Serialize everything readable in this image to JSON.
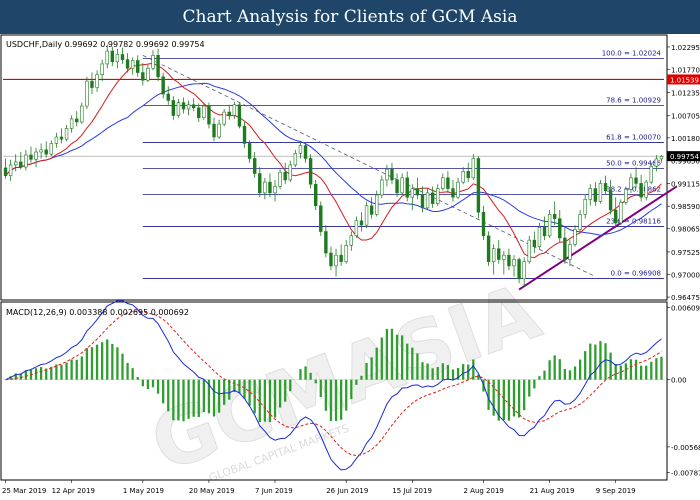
{
  "banner": {
    "title": "Chart Analysis for Clients of GCM Asia",
    "background": "#1f4668"
  },
  "watermark": {
    "text": "GCMASIA",
    "subtext": "GLOBAL CAPITAL MARKETS"
  },
  "chart_data": [
    {
      "type": "candlestick",
      "header": "USDCHF,Daily  0.99692 0.99782 0.99692 0.99754",
      "ylim": [
        0.9643,
        1.0255
      ],
      "y_ticks": [
        {
          "label": "1.02295",
          "value": 1.02295
        },
        {
          "label": "1.01770",
          "value": 1.0177
        },
        {
          "label": "1.01235",
          "value": 1.01235
        },
        {
          "label": "1.00705",
          "value": 1.00705
        },
        {
          "label": "1.00180",
          "value": 1.0018
        },
        {
          "label": "0.99650",
          "value": 0.9965
        },
        {
          "label": "0.99115",
          "value": 0.99115
        },
        {
          "label": "0.98590",
          "value": 0.9859
        },
        {
          "label": "0.98065",
          "value": 0.98065
        },
        {
          "label": "0.97525",
          "value": 0.97525
        },
        {
          "label": "0.97000",
          "value": 0.97
        },
        {
          "label": "0.96475",
          "value": 0.96475
        }
      ],
      "fib_levels": [
        {
          "label": "100.0 = 1.02024",
          "value": 1.02024
        },
        {
          "label": "78.6 = 1.00929",
          "value": 1.00929
        },
        {
          "label": "61.8 = 1.00070",
          "value": 1.0007
        },
        {
          "label": "50.0 = 0.99466",
          "value": 0.99466
        },
        {
          "label": "38.2 = 0.98862",
          "value": 0.98862
        },
        {
          "label": "23.6 = 0.98116",
          "value": 0.98116
        },
        {
          "label": "0.0 = 0.96908",
          "value": 0.96908
        }
      ],
      "resistance_level": {
        "label": "1.01539",
        "value": 1.01539
      },
      "current_price": {
        "label": "0.99754",
        "value": 0.99754
      },
      "colors": {
        "fib": "#1c1c8a",
        "resistance": "#e00000",
        "ma_fast": "#d21e1e",
        "ma_slow": "#2a3ce0",
        "trendline": "#800080",
        "downtrend": "#555577",
        "candle": "#1f7a1f",
        "current_price_bg": "#000000"
      },
      "ohlc": [
        {
          "o": 0.9948,
          "h": 0.997,
          "l": 0.9923,
          "c": 0.993
        },
        {
          "o": 0.993,
          "h": 0.9967,
          "l": 0.9918,
          "c": 0.9955
        },
        {
          "o": 0.9955,
          "h": 0.998,
          "l": 0.994,
          "c": 0.9962
        },
        {
          "o": 0.9962,
          "h": 0.9985,
          "l": 0.9945,
          "c": 0.995
        },
        {
          "o": 0.995,
          "h": 0.999,
          "l": 0.9942,
          "c": 0.9978
        },
        {
          "o": 0.9978,
          "h": 0.9998,
          "l": 0.996,
          "c": 0.9968
        },
        {
          "o": 0.9968,
          "h": 0.9995,
          "l": 0.995,
          "c": 0.9985
        },
        {
          "o": 0.9985,
          "h": 1.0005,
          "l": 0.997,
          "c": 0.999
        },
        {
          "o": 0.999,
          "h": 1.001,
          "l": 0.9972,
          "c": 0.998
        },
        {
          "o": 0.998,
          "h": 1.0012,
          "l": 0.9975,
          "c": 1.0005
        },
        {
          "o": 1.0005,
          "h": 1.003,
          "l": 0.9995,
          "c": 1.002
        },
        {
          "o": 1.002,
          "h": 1.004,
          "l": 1.0005,
          "c": 1.0015
        },
        {
          "o": 1.0015,
          "h": 1.0048,
          "l": 1.001,
          "c": 1.004
        },
        {
          "o": 1.004,
          "h": 1.007,
          "l": 1.003,
          "c": 1.0062
        },
        {
          "o": 1.0062,
          "h": 1.008,
          "l": 1.0045,
          "c": 1.0055
        },
        {
          "o": 1.0055,
          "h": 1.01,
          "l": 1.005,
          "c": 1.0092
        },
        {
          "o": 1.0092,
          "h": 1.016,
          "l": 1.0085,
          "c": 1.015
        },
        {
          "o": 1.015,
          "h": 1.017,
          "l": 1.012,
          "c": 1.0135
        },
        {
          "o": 1.0135,
          "h": 1.0175,
          "l": 1.0125,
          "c": 1.0165
        },
        {
          "o": 1.0165,
          "h": 1.02,
          "l": 1.015,
          "c": 1.019
        },
        {
          "o": 1.019,
          "h": 1.0235,
          "l": 1.018,
          "c": 1.022
        },
        {
          "o": 1.022,
          "h": 1.023,
          "l": 1.0185,
          "c": 1.0195
        },
        {
          "o": 1.0195,
          "h": 1.0225,
          "l": 1.018,
          "c": 1.0212
        },
        {
          "o": 1.0212,
          "h": 1.0228,
          "l": 1.019,
          "c": 1.02
        },
        {
          "o": 1.02,
          "h": 1.0215,
          "l": 1.017,
          "c": 1.018
        },
        {
          "o": 1.018,
          "h": 1.0205,
          "l": 1.0165,
          "c": 1.0198
        },
        {
          "o": 1.0198,
          "h": 1.021,
          "l": 1.016,
          "c": 1.017
        },
        {
          "o": 1.017,
          "h": 1.0192,
          "l": 1.014,
          "c": 1.0152
        },
        {
          "o": 1.0152,
          "h": 1.0188,
          "l": 1.0148,
          "c": 1.018
        },
        {
          "o": 1.018,
          "h": 1.0222,
          "l": 1.0175,
          "c": 1.021
        },
        {
          "o": 1.021,
          "h": 1.0225,
          "l": 1.015,
          "c": 1.016
        },
        {
          "o": 1.016,
          "h": 1.017,
          "l": 1.011,
          "c": 1.012
        },
        {
          "o": 1.012,
          "h": 1.0138,
          "l": 1.0095,
          "c": 1.0105
        },
        {
          "o": 1.0105,
          "h": 1.0115,
          "l": 1.006,
          "c": 1.007
        },
        {
          "o": 1.007,
          "h": 1.0108,
          "l": 1.0065,
          "c": 1.01
        },
        {
          "o": 1.01,
          "h": 1.0112,
          "l": 1.0075,
          "c": 1.0085
        },
        {
          "o": 1.0085,
          "h": 1.0105,
          "l": 1.007,
          "c": 1.0095
        },
        {
          "o": 1.0095,
          "h": 1.011,
          "l": 1.008,
          "c": 1.0088
        },
        {
          "o": 1.0088,
          "h": 1.0098,
          "l": 1.0055,
          "c": 1.0065
        },
        {
          "o": 1.0065,
          "h": 1.01,
          "l": 1.006,
          "c": 1.0092
        },
        {
          "o": 1.0092,
          "h": 1.01,
          "l": 1.004,
          "c": 1.005
        },
        {
          "o": 1.005,
          "h": 1.0065,
          "l": 1.001,
          "c": 1.002
        },
        {
          "o": 1.002,
          "h": 1.006,
          "l": 1.0015,
          "c": 1.005
        },
        {
          "o": 1.005,
          "h": 1.0085,
          "l": 1.0045,
          "c": 1.0078
        },
        {
          "o": 1.0078,
          "h": 1.0095,
          "l": 1.006,
          "c": 1.007
        },
        {
          "o": 1.007,
          "h": 1.0102,
          "l": 1.0062,
          "c": 1.0095
        },
        {
          "o": 1.0095,
          "h": 1.01,
          "l": 1.004,
          "c": 1.0045
        },
        {
          "o": 1.0045,
          "h": 1.0055,
          "l": 0.9995,
          "c": 1.0005
        },
        {
          "o": 1.0005,
          "h": 1.0012,
          "l": 0.996,
          "c": 0.997
        },
        {
          "o": 0.997,
          "h": 0.9985,
          "l": 0.9925,
          "c": 0.9935
        },
        {
          "o": 0.9935,
          "h": 0.995,
          "l": 0.988,
          "c": 0.989
        },
        {
          "o": 0.989,
          "h": 0.9925,
          "l": 0.9875,
          "c": 0.9915
        },
        {
          "o": 0.9915,
          "h": 0.9935,
          "l": 0.988,
          "c": 0.989
        },
        {
          "o": 0.989,
          "h": 0.992,
          "l": 0.987,
          "c": 0.9905
        },
        {
          "o": 0.9905,
          "h": 0.9945,
          "l": 0.9898,
          "c": 0.9938
        },
        {
          "o": 0.9938,
          "h": 0.996,
          "l": 0.991,
          "c": 0.992
        },
        {
          "o": 0.992,
          "h": 0.9965,
          "l": 0.9915,
          "c": 0.9955
        },
        {
          "o": 0.9955,
          "h": 0.999,
          "l": 0.995,
          "c": 0.9982
        },
        {
          "o": 0.9982,
          "h": 1.001,
          "l": 0.997,
          "c": 1.0
        },
        {
          "o": 1.0,
          "h": 1.0008,
          "l": 0.996,
          "c": 0.997
        },
        {
          "o": 0.997,
          "h": 0.998,
          "l": 0.99,
          "c": 0.991
        },
        {
          "o": 0.991,
          "h": 0.992,
          "l": 0.985,
          "c": 0.986
        },
        {
          "o": 0.986,
          "h": 0.987,
          "l": 0.979,
          "c": 0.98
        },
        {
          "o": 0.98,
          "h": 0.9815,
          "l": 0.974,
          "c": 0.975
        },
        {
          "o": 0.975,
          "h": 0.9765,
          "l": 0.971,
          "c": 0.972
        },
        {
          "o": 0.972,
          "h": 0.976,
          "l": 0.9695,
          "c": 0.9745
        },
        {
          "o": 0.9745,
          "h": 0.977,
          "l": 0.972,
          "c": 0.973
        },
        {
          "o": 0.973,
          "h": 0.978,
          "l": 0.9725,
          "c": 0.9768
        },
        {
          "o": 0.9768,
          "h": 0.98,
          "l": 0.9755,
          "c": 0.979
        },
        {
          "o": 0.979,
          "h": 0.9835,
          "l": 0.9785,
          "c": 0.9825
        },
        {
          "o": 0.9825,
          "h": 0.9845,
          "l": 0.98,
          "c": 0.9815
        },
        {
          "o": 0.9815,
          "h": 0.987,
          "l": 0.9808,
          "c": 0.986
        },
        {
          "o": 0.986,
          "h": 0.988,
          "l": 0.983,
          "c": 0.984
        },
        {
          "o": 0.984,
          "h": 0.9895,
          "l": 0.9835,
          "c": 0.9885
        },
        {
          "o": 0.9885,
          "h": 0.993,
          "l": 0.9878,
          "c": 0.992
        },
        {
          "o": 0.992,
          "h": 0.9955,
          "l": 0.9905,
          "c": 0.9945
        },
        {
          "o": 0.9945,
          "h": 0.996,
          "l": 0.991,
          "c": 0.992
        },
        {
          "o": 0.992,
          "h": 0.9935,
          "l": 0.988,
          "c": 0.989
        },
        {
          "o": 0.989,
          "h": 0.9935,
          "l": 0.9885,
          "c": 0.9925
        },
        {
          "o": 0.9925,
          "h": 0.994,
          "l": 0.987,
          "c": 0.988
        },
        {
          "o": 0.988,
          "h": 0.991,
          "l": 0.985,
          "c": 0.99
        },
        {
          "o": 0.99,
          "h": 0.9925,
          "l": 0.9875,
          "c": 0.9885
        },
        {
          "o": 0.9885,
          "h": 0.9905,
          "l": 0.9845,
          "c": 0.9855
        },
        {
          "o": 0.9855,
          "h": 0.99,
          "l": 0.985,
          "c": 0.989
        },
        {
          "o": 0.989,
          "h": 0.9905,
          "l": 0.9855,
          "c": 0.9865
        },
        {
          "o": 0.9865,
          "h": 0.991,
          "l": 0.986,
          "c": 0.99
        },
        {
          "o": 0.99,
          "h": 0.9935,
          "l": 0.9895,
          "c": 0.9925
        },
        {
          "o": 0.9925,
          "h": 0.994,
          "l": 0.989,
          "c": 0.99
        },
        {
          "o": 0.99,
          "h": 0.992,
          "l": 0.987,
          "c": 0.988
        },
        {
          "o": 0.988,
          "h": 0.9925,
          "l": 0.9875,
          "c": 0.9915
        },
        {
          "o": 0.9915,
          "h": 0.995,
          "l": 0.991,
          "c": 0.994
        },
        {
          "o": 0.994,
          "h": 0.996,
          "l": 0.9915,
          "c": 0.9925
        },
        {
          "o": 0.9925,
          "h": 0.998,
          "l": 0.992,
          "c": 0.997
        },
        {
          "o": 0.997,
          "h": 0.9975,
          "l": 0.983,
          "c": 0.9845
        },
        {
          "o": 0.9845,
          "h": 0.986,
          "l": 0.978,
          "c": 0.979
        },
        {
          "o": 0.979,
          "h": 0.98,
          "l": 0.972,
          "c": 0.973
        },
        {
          "o": 0.973,
          "h": 0.977,
          "l": 0.97,
          "c": 0.976
        },
        {
          "o": 0.976,
          "h": 0.978,
          "l": 0.9725,
          "c": 0.9735
        },
        {
          "o": 0.9735,
          "h": 0.9755,
          "l": 0.97,
          "c": 0.9745
        },
        {
          "o": 0.9745,
          "h": 0.976,
          "l": 0.971,
          "c": 0.972
        },
        {
          "o": 0.972,
          "h": 0.9745,
          "l": 0.9695,
          "c": 0.9735
        },
        {
          "o": 0.9735,
          "h": 0.974,
          "l": 0.968,
          "c": 0.969
        },
        {
          "o": 0.969,
          "h": 0.974,
          "l": 0.967,
          "c": 0.973
        },
        {
          "o": 0.973,
          "h": 0.979,
          "l": 0.9725,
          "c": 0.978
        },
        {
          "o": 0.978,
          "h": 0.98,
          "l": 0.975,
          "c": 0.9765
        },
        {
          "o": 0.9765,
          "h": 0.982,
          "l": 0.976,
          "c": 0.981
        },
        {
          "o": 0.981,
          "h": 0.9835,
          "l": 0.978,
          "c": 0.979
        },
        {
          "o": 0.979,
          "h": 0.985,
          "l": 0.9785,
          "c": 0.984
        },
        {
          "o": 0.984,
          "h": 0.987,
          "l": 0.9815,
          "c": 0.983
        },
        {
          "o": 0.983,
          "h": 0.985,
          "l": 0.9775,
          "c": 0.9785
        },
        {
          "o": 0.9785,
          "h": 0.981,
          "l": 0.9725,
          "c": 0.9735
        },
        {
          "o": 0.9735,
          "h": 0.978,
          "l": 0.972,
          "c": 0.977
        },
        {
          "o": 0.977,
          "h": 0.9815,
          "l": 0.9765,
          "c": 0.9805
        },
        {
          "o": 0.9805,
          "h": 0.985,
          "l": 0.98,
          "c": 0.984
        },
        {
          "o": 0.984,
          "h": 0.9885,
          "l": 0.983,
          "c": 0.9875
        },
        {
          "o": 0.9875,
          "h": 0.991,
          "l": 0.986,
          "c": 0.99
        },
        {
          "o": 0.99,
          "h": 0.9915,
          "l": 0.986,
          "c": 0.987
        },
        {
          "o": 0.987,
          "h": 0.992,
          "l": 0.9865,
          "c": 0.9912
        },
        {
          "o": 0.9912,
          "h": 0.993,
          "l": 0.9885,
          "c": 0.9895
        },
        {
          "o": 0.9895,
          "h": 0.992,
          "l": 0.984,
          "c": 0.985
        },
        {
          "o": 0.985,
          "h": 0.988,
          "l": 0.9808,
          "c": 0.982
        },
        {
          "o": 0.982,
          "h": 0.9875,
          "l": 0.9815,
          "c": 0.9868
        },
        {
          "o": 0.9868,
          "h": 0.9905,
          "l": 0.9862,
          "c": 0.9898
        },
        {
          "o": 0.9898,
          "h": 0.9935,
          "l": 0.989,
          "c": 0.9925
        },
        {
          "o": 0.9925,
          "h": 0.995,
          "l": 0.99,
          "c": 0.9912
        },
        {
          "o": 0.9912,
          "h": 0.9932,
          "l": 0.987,
          "c": 0.988
        },
        {
          "o": 0.988,
          "h": 0.992,
          "l": 0.9872,
          "c": 0.9915
        },
        {
          "o": 0.9915,
          "h": 0.996,
          "l": 0.991,
          "c": 0.9952
        },
        {
          "o": 0.9952,
          "h": 0.9978,
          "l": 0.994,
          "c": 0.9969
        },
        {
          "o": 0.9969,
          "h": 0.9978,
          "l": 0.996,
          "c": 0.9975
        }
      ]
    },
    {
      "type": "macd",
      "header": "MACD(12,26,9) 0.003388 0.002695 0.000692",
      "ylim": [
        -0.0084,
        0.0064
      ],
      "y_ticks": [
        {
          "label": "0.00609",
          "value": 0.00609
        },
        {
          "label": "0.00",
          "value": 0.0
        },
        {
          "label": "-0.00568",
          "value": -0.00568
        },
        {
          "label": "-0.00787",
          "value": -0.00787
        }
      ],
      "colors": {
        "macd": "#1a2ad8",
        "signal": "#e02020",
        "histogram": "#2e9e2e"
      },
      "x_labels": [
        {
          "label": "25 Mar 2019",
          "index": 0
        },
        {
          "label": "12 Apr 2019",
          "index": 13
        },
        {
          "label": "1 May 2019",
          "index": 27
        },
        {
          "label": "20 May 2019",
          "index": 40
        },
        {
          "label": "7 Jun 2019",
          "index": 53
        },
        {
          "label": "26 Jun 2019",
          "index": 67
        },
        {
          "label": "15 Jul 2019",
          "index": 80
        },
        {
          "label": "2 Aug 2019",
          "index": 94
        },
        {
          "label": "21 Aug 2019",
          "index": 107
        },
        {
          "label": "9 Sep 2019",
          "index": 120
        }
      ]
    }
  ]
}
